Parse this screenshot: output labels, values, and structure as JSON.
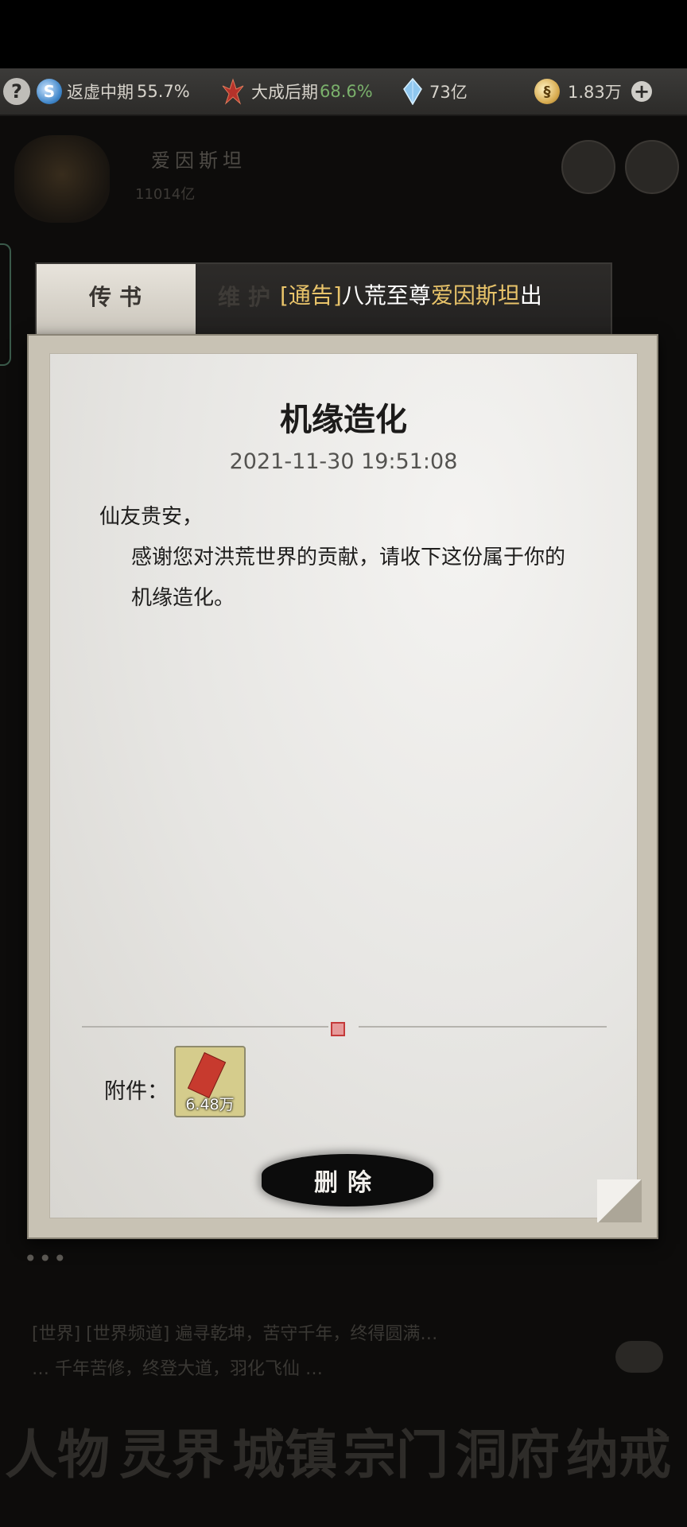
{
  "statusbar": {
    "help_icon": "question-icon",
    "realm1": {
      "icon": "taiji-icon",
      "label": "返虚中期",
      "value": "55.7%"
    },
    "realm2": {
      "icon": "crest-icon",
      "label": "大成后期",
      "value": "68.6%",
      "value_color": "#7ab06b"
    },
    "crystal": {
      "icon": "crystal-icon",
      "value": "73亿"
    },
    "coins": {
      "icon": "coin-icon",
      "value": "1.83万"
    },
    "plus_icon": "plus-icon"
  },
  "background": {
    "player_name": "爱因斯坦",
    "player_sub": "11014亿",
    "chat_lines": [
      "[世界] [世界频道] 遍寻乾坤，苦守千年，终得圆满…",
      "… 千年苦修，终登大道，羽化飞仙 …"
    ],
    "nav": [
      "人物",
      "灵界",
      "城镇",
      "宗门",
      "洞府",
      "纳戒"
    ]
  },
  "tabs": {
    "mail": "传书",
    "maintenance": "维护",
    "notice_tag": "[通告]",
    "notice_pre": "八荒至尊",
    "notice_name": "爱因斯坦",
    "notice_post": "出"
  },
  "letter": {
    "title": "机缘造化",
    "date": "2021-11-30 19:51:08",
    "greeting": "仙友贵安，",
    "body": "感谢您对洪荒世界的贡献，请收下这份属于你的机缘造化。",
    "attachment_label": "附件：",
    "attachment": {
      "icon": "talisman-icon",
      "count": "6.48万"
    },
    "delete_label": "删除"
  },
  "colors": {
    "accent_gold": "#e9c46a",
    "accent_green": "#7ab06b"
  }
}
